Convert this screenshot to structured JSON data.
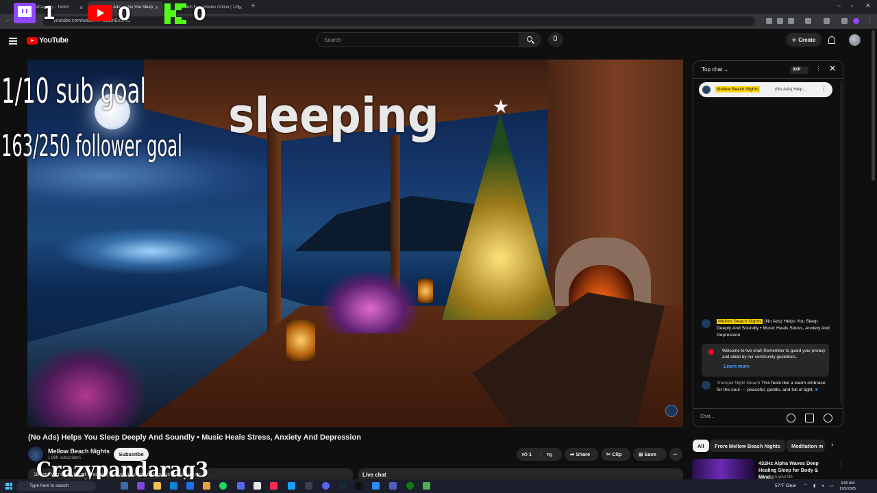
{
  "browser": {
    "tabs": [
      {
        "label": "yourCanaary - Twitch"
      },
      {
        "label": "(No Ads) Helps You Sleep"
      },
      {
        "label": "Watch Free Movies Online | 123"
      }
    ],
    "new_tab": "+",
    "url": "youtube.com/watch?v=u1qmEx9mC"
  },
  "overlays": {
    "twitch_count": "1",
    "youtube_count": "0",
    "kick_count": "0",
    "sub_goal": "1/10 sub goal",
    "follower_goal": "163/250 follower goal",
    "status": "sleeping",
    "streamer": "Crazypandarag3"
  },
  "header": {
    "brand": "YouTube",
    "search_placeholder": "Search",
    "create_label": "Create"
  },
  "video": {
    "title": "(No Ads) Helps You Sleep Deeply And Soundly • Music Heals Stress, Anxiety And Depression",
    "channel": "Mellow Beach Nights",
    "subscribers": "1.88K subscribers",
    "subscribe_label": "Subscribe",
    "like_count": "1",
    "share_label": "Share",
    "clip_label": "Clip",
    "save_label": "Save",
    "more_label": "...",
    "description_preview": "18 watching now  Started streaming  #sleepmusic  #relaxingmusic  #oceanwaves",
    "live_chat_label": "Live chat"
  },
  "chat": {
    "mode": "Top chat",
    "xp": "0XP",
    "pinned_name": "Mellow Beach Nights",
    "pinned_text": "(No Ads) Help...",
    "messages": [
      {
        "author": "Mellow Beach Nights",
        "text": "(No Ads) Helps You Sleep Deeply And Soundly • Music Heals Stress, Anxiety And Depression"
      },
      {
        "author": "Tranquil Night Beach",
        "text": "This feels like a warm embrace for the soul — peaceful, gentle, and full of light."
      }
    ],
    "welcome": "Welcome to live chat! Remember to guard your privacy and abide by our community guidelines.",
    "learn_more": "Learn more",
    "input_placeholder": "Chat..."
  },
  "chips": [
    {
      "label": "All"
    },
    {
      "label": "From Mellow Beach Nights"
    },
    {
      "label": "Meditation m"
    }
  ],
  "recommendation": {
    "title": "432Hz Alpha Waves  Deep Healing Sleep for Body & Mind...",
    "sub": "Transform your life"
  },
  "taskbar": {
    "search_placeholder": "Type here to search",
    "weather": "57°F  Clear",
    "time": "4:00 AM",
    "date": "11/5/2025"
  },
  "colors": {
    "youtube_red": "#ff0000",
    "twitch_purple": "#9146ff",
    "kick_green": "#53fc18",
    "highlight_yellow": "#ffd600",
    "link_blue": "#3ea6ff"
  }
}
